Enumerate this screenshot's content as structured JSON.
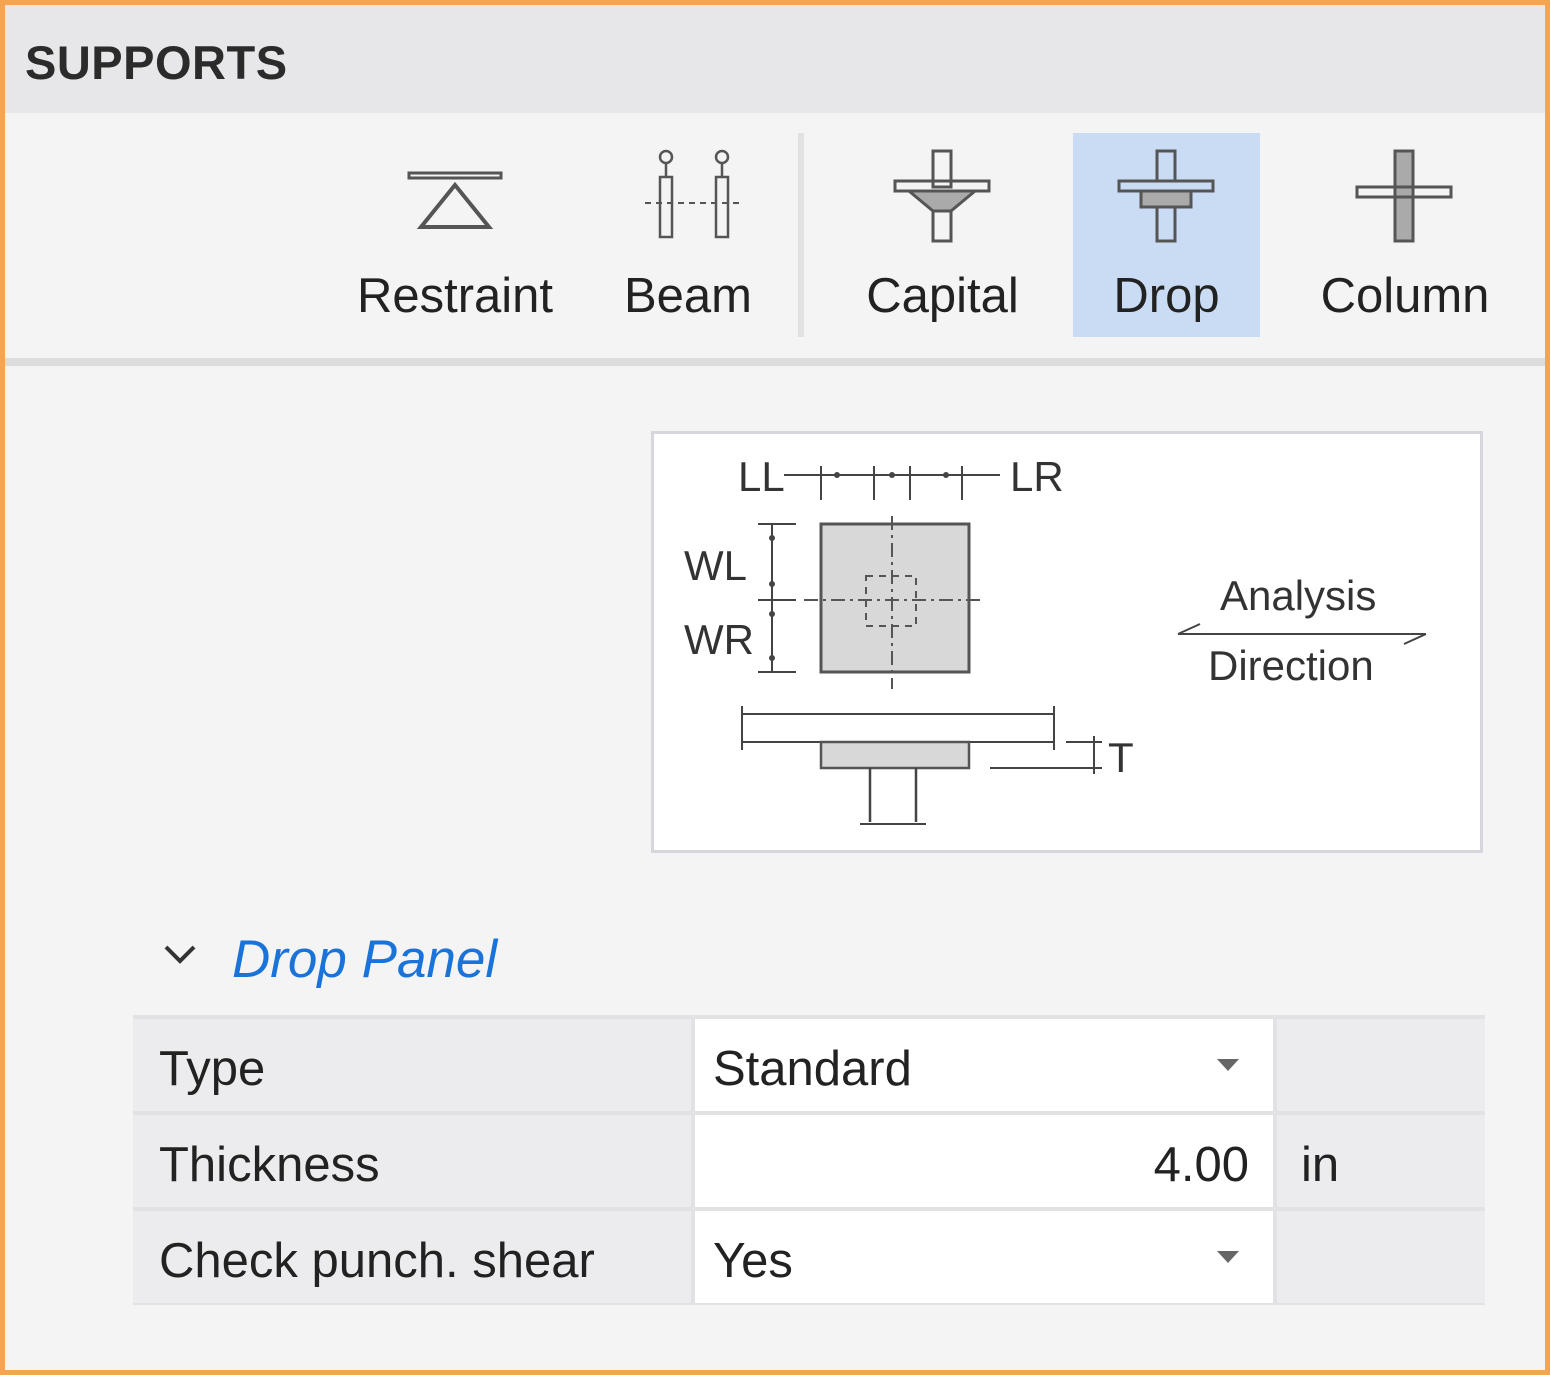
{
  "panel": {
    "title": "SUPPORTS"
  },
  "toolbar": {
    "items": [
      {
        "label": "Restraint",
        "icon": "restraint-icon",
        "active": false
      },
      {
        "label": "Beam",
        "icon": "beam-support-icon",
        "active": false
      },
      {
        "label": "Capital",
        "icon": "capital-icon",
        "active": false
      },
      {
        "label": "Drop",
        "icon": "drop-panel-icon",
        "active": true
      },
      {
        "label": "Column",
        "icon": "column-icon",
        "active": false
      }
    ]
  },
  "diagram": {
    "labels": {
      "ll": "LL",
      "lr": "LR",
      "wl": "WL",
      "wr": "WR",
      "t": "T",
      "analysis": "Analysis",
      "direction": "Direction"
    }
  },
  "section": {
    "title": "Drop Panel",
    "expanded": true,
    "rows": [
      {
        "name": "Type",
        "value": "Standard",
        "unit": "",
        "dropdown": true
      },
      {
        "name": "Thickness",
        "value": "4.00",
        "unit": "in",
        "dropdown": false
      },
      {
        "name": "Check punch. shear",
        "value": "Yes",
        "unit": "",
        "dropdown": true
      }
    ]
  },
  "colors": {
    "accent": "#1a73d9",
    "active_tool": "#c9dcf3",
    "border": "#f5a552"
  }
}
